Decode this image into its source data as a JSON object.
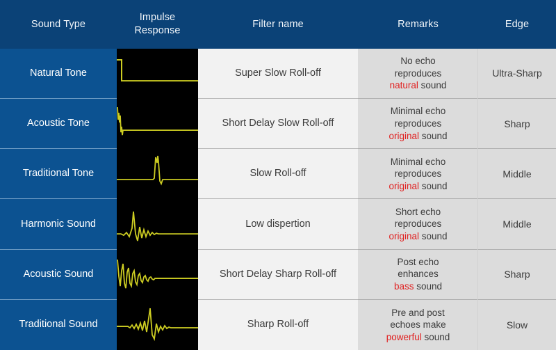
{
  "header": {
    "columns": [
      {
        "label": "Sound Type",
        "name": "col-sound-type"
      },
      {
        "label_line1": "Impulse",
        "label_line2": "Response",
        "name": "col-impulse-response"
      },
      {
        "label": "Filter name",
        "name": "col-filter-name"
      },
      {
        "label": "Remarks",
        "name": "col-remarks"
      },
      {
        "label": "Edge",
        "name": "col-edge"
      }
    ]
  },
  "colors": {
    "header_blue": "#0b4277",
    "row_blue": "#0c5291",
    "filter_gray": "#f2f2f2",
    "remarks_gray": "#dcdcdc",
    "scope_background": "#000000",
    "waveform": "#cccc22",
    "highlight_red": "#e02020"
  },
  "rows": [
    {
      "sound_type": "Natural Tone",
      "impulse_response": "step-decay-waveform",
      "filter_name": "Super Slow Roll-off",
      "remarks": {
        "line1": "No echo",
        "line2": "reproduces",
        "line3_highlight": "natural",
        "line3_rest": " sound"
      },
      "edge": "Ultra-Sharp"
    },
    {
      "sound_type": "Acoustic Tone",
      "impulse_response": "leading-spike-waveform",
      "filter_name": "Short Delay Slow Roll-off",
      "remarks": {
        "line1": "Minimal echo",
        "line2": "reproduces",
        "line3_highlight": "original",
        "line3_rest": " sound"
      },
      "edge": "Sharp"
    },
    {
      "sound_type": "Traditional Tone",
      "impulse_response": "centered-narrow-spike-waveform",
      "filter_name": "Slow Roll-off",
      "remarks": {
        "line1": "Minimal echo",
        "line2": "reproduces",
        "line3_highlight": "original",
        "line3_rest": " sound"
      },
      "edge": "Middle"
    },
    {
      "sound_type": "Harmonic Sound",
      "impulse_response": "short-ringing-waveform",
      "filter_name": "Low dispertion",
      "remarks": {
        "line1": "Short echo",
        "line2": "reproduces",
        "line3_highlight": "original",
        "line3_rest": " sound"
      },
      "edge": "Middle"
    },
    {
      "sound_type": "Acoustic Sound",
      "impulse_response": "post-ringing-waveform",
      "filter_name": "Short Delay Sharp Roll-off",
      "remarks": {
        "line1": "Post echo",
        "line2": "enhances",
        "line3_highlight": "bass",
        "line3_rest": " sound"
      },
      "edge": "Sharp"
    },
    {
      "sound_type": "Traditional Sound",
      "impulse_response": "pre-post-ringing-waveform",
      "filter_name": "Sharp Roll-off",
      "remarks": {
        "line1": "Pre and post",
        "line2": "echoes make",
        "line3_highlight": "powerful",
        "line3_rest": " sound"
      },
      "edge": "Slow"
    }
  ]
}
